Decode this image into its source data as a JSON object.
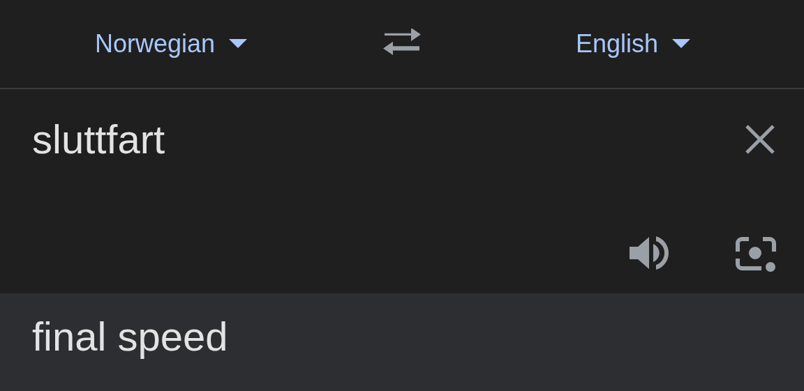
{
  "languages": {
    "source": "Norwegian",
    "target": "English"
  },
  "input": {
    "value": "sluttfart"
  },
  "output": {
    "text": "final speed"
  }
}
